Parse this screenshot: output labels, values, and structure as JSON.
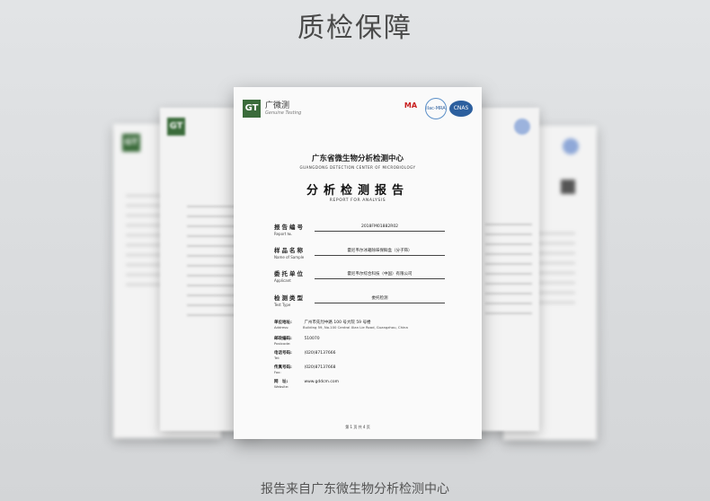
{
  "header": {
    "title": "质检保障"
  },
  "caption": "报告来自广东微生物分析检测中心",
  "report": {
    "brand_name": "广微测",
    "brand_sub": "Genuine Testing",
    "certs": [
      "MA",
      "ilac-MRA",
      "CNAS"
    ],
    "org_cn": "广东省微生物分析检测中心",
    "org_en": "GUANGDONG DETECTION CENTER OF MICROBIOLOGY",
    "title_cn": "分析检测报告",
    "title_en": "REPORT FOR ANALYSIS",
    "fields": [
      {
        "label": "报告编号",
        "label_en": "Report №.",
        "value": "2018FM01882R02"
      },
      {
        "label": "样品名称",
        "label_en": "Name of Sample",
        "value": "霍尼韦尔冰箱除味保鲜盒（分子筛）"
      },
      {
        "label": "委托单位",
        "label_en": "Applicant",
        "value": "霍尼韦尔综合科技（中国）有限公司"
      },
      {
        "label": "检测类型",
        "label_en": "Test Type",
        "value": "委托检测"
      }
    ],
    "info": [
      {
        "key": "单位地址:",
        "key_en": "Address:",
        "value": "广州市先烈中路 100 号大院 59 号楼",
        "value_en": "Building 59, No.100 Central Xian Lie Road, Guangzhou, China"
      },
      {
        "key": "邮政编码:",
        "key_en": "Postcode:",
        "value": "510070",
        "value_en": ""
      },
      {
        "key": "电话号码:",
        "key_en": "Tel:",
        "value": "(020)87137666",
        "value_en": ""
      },
      {
        "key": "传真号码:",
        "key_en": "Fax:",
        "value": "(020)87137668",
        "value_en": ""
      },
      {
        "key": "网　址:",
        "key_en": "Website:",
        "value": "www.gddcm.com",
        "value_en": ""
      }
    ],
    "page_no": "第 1 页 共 4 页"
  }
}
